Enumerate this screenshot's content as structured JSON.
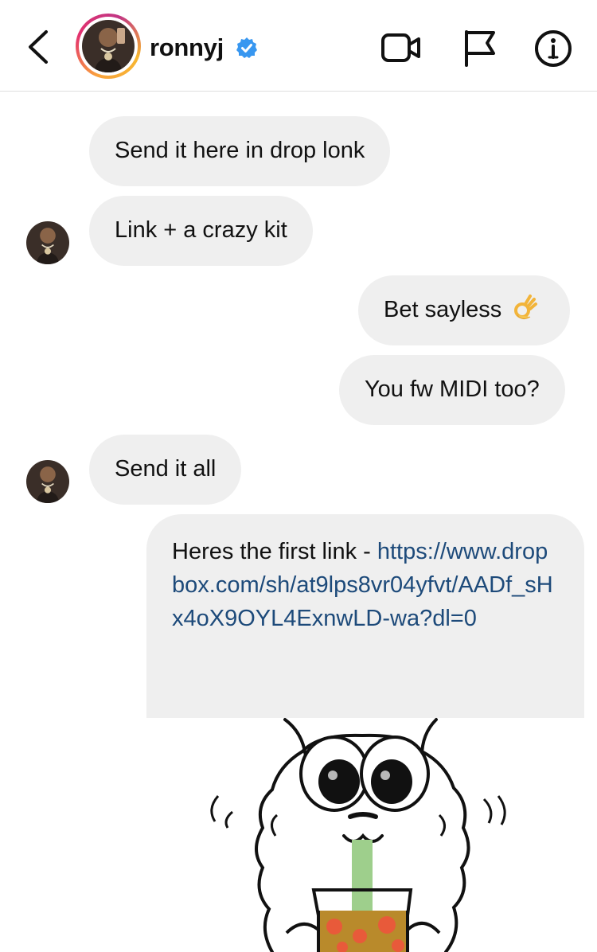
{
  "header": {
    "username": "ronnyj",
    "verified": true,
    "back_icon": "chevron-left-icon",
    "actions": [
      "video-call-icon",
      "flag-icon",
      "info-icon"
    ]
  },
  "messages": [
    {
      "from": "ronnyj",
      "text": "Send it here in drop lonk"
    },
    {
      "from": "ronnyj",
      "text": "Link + a crazy kit"
    },
    {
      "from": "me",
      "text": "Bet sayless",
      "emoji": "ok-hand-icon"
    },
    {
      "from": "me",
      "text": "You fw MIDI too?"
    },
    {
      "from": "ronnyj",
      "text": "Send it all"
    },
    {
      "from": "me",
      "text": "Heres the first link - ",
      "link": "https://www.dropbox.com/sh/at9lps8vr04yfvt/AADf_sHx4oX9OYL4ExnwLD-wa?dl=0"
    }
  ],
  "sticker": {
    "name": "fluffy-creature-drinking-bubble-tea-sticker"
  },
  "colors": {
    "bubble": "#efefef",
    "link": "#1d4a7a",
    "verified_badge": "#3897f0",
    "divider": "#dedede"
  }
}
